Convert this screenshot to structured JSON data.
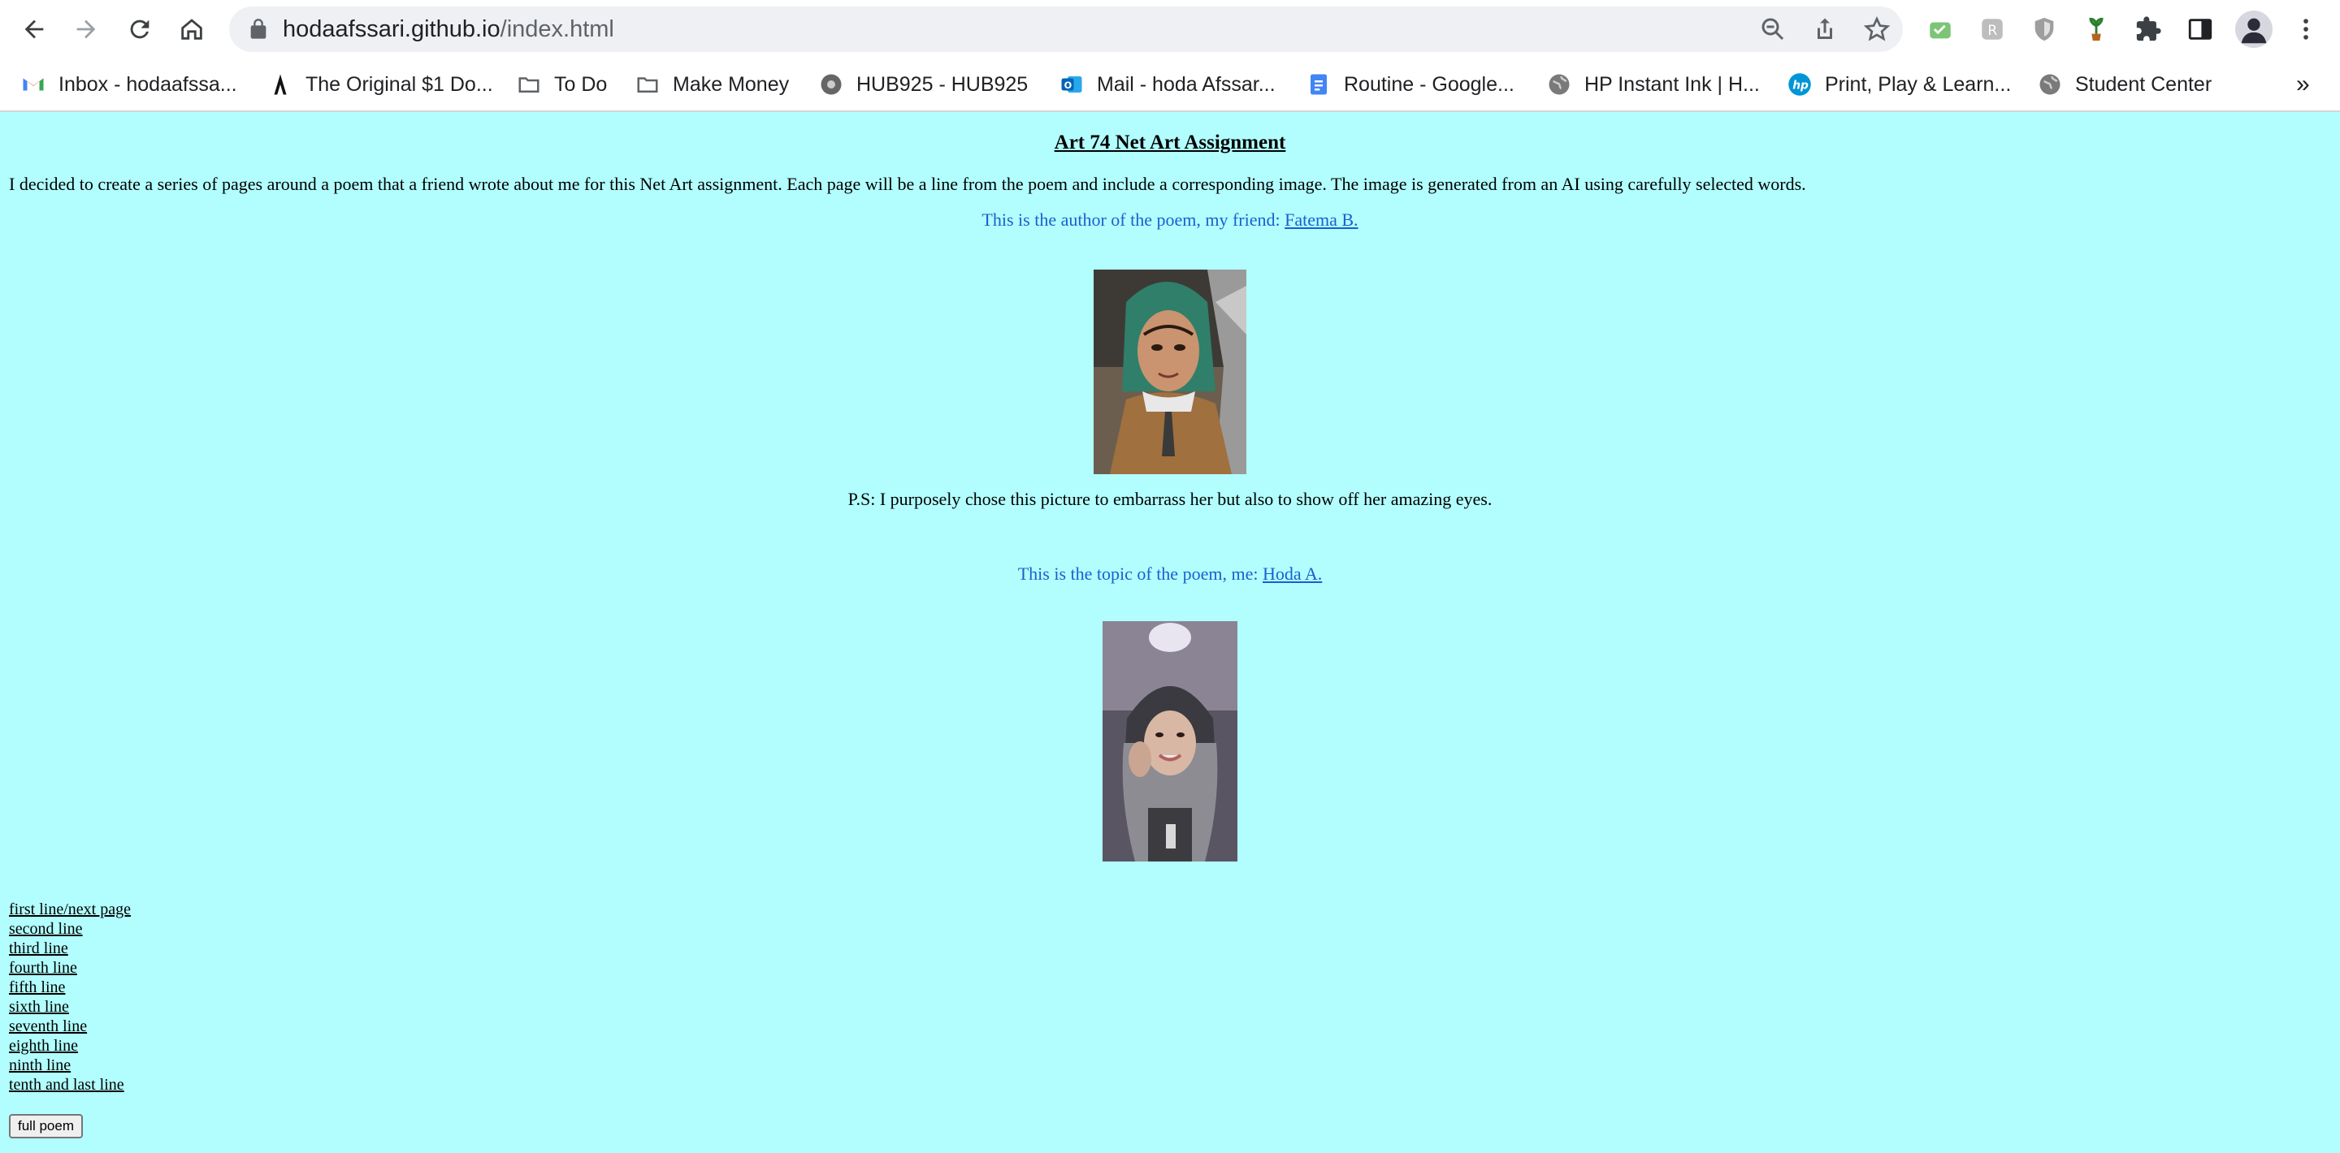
{
  "browser": {
    "url_host": "hodaafssari.github.io",
    "url_path": "/index.html",
    "bookmarks": [
      {
        "label": "Inbox - hodaafssa...",
        "icon": "gmail-icon"
      },
      {
        "label": "The Original $1 Do...",
        "icon": "dollar-site-icon"
      },
      {
        "label": "To Do",
        "icon": "folder-icon"
      },
      {
        "label": "Make Money",
        "icon": "folder-icon"
      },
      {
        "label": "HUB925 - HUB925",
        "icon": "hub-icon"
      },
      {
        "label": "Mail - hoda Afssar...",
        "icon": "outlook-icon"
      },
      {
        "label": "Routine - Google...",
        "icon": "google-docs-icon"
      },
      {
        "label": "HP Instant Ink | H...",
        "icon": "globe-icon"
      },
      {
        "label": "Print, Play & Learn...",
        "icon": "hp-icon"
      },
      {
        "label": "Student Center",
        "icon": "globe-icon"
      }
    ],
    "overflow_label": "»",
    "accent_color": "#1a73e8"
  },
  "page": {
    "title": "Art 74 Net Art Assignment",
    "intro": "I decided to create a series of pages around a poem that a friend wrote about me for this Net Art assignment. Each page will be a line from the poem and include a corresponding image. The image is generated from an AI using carefully selected words.",
    "author_prefix": "This is the author of the poem, my friend: ",
    "author_link": "Fatema B.",
    "ps": "P.S: I purposely chose this picture to embarrass her but also to show off her amazing eyes.",
    "topic_prefix": "This is the topic of the poem, me: ",
    "topic_link": "Hoda A.",
    "lines": [
      "first line/next page",
      "second line",
      "third line",
      "fourth line",
      "fifth line",
      "sixth line",
      "seventh line",
      "eighth line",
      "ninth line",
      "tenth and last line"
    ],
    "full_poem_button": "full poem",
    "background_color": "#b2fefe",
    "link_color": "#1a5fcf"
  }
}
